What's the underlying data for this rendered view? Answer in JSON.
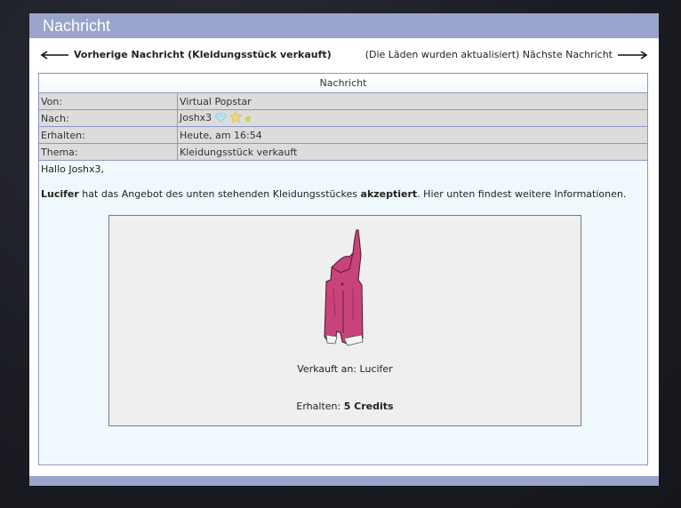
{
  "window": {
    "title": "Nachricht"
  },
  "nav": {
    "prev_label": "Vorherige Nachricht (Kleidungsstück verkauft)",
    "next_label": "(Die Läden wurden aktualisiert) Nächste Nachricht"
  },
  "message": {
    "header": "Nachricht",
    "fields": [
      {
        "key": "Von:",
        "value": "Virtual Popstar"
      },
      {
        "key": "Nach:",
        "value": "Joshx3"
      },
      {
        "key": "Erhalten:",
        "value": "Heute, am 16:54"
      },
      {
        "key": "Thema:",
        "value": "Kleidungsstück verkauft"
      }
    ],
    "greeting": "Hallo Joshx3,",
    "body": {
      "buyer": "Lucifer",
      "text1": " hat das Angebot des unten stehenden Kleidungsstückes ",
      "accepted": "akzeptiert",
      "text2": ". Hier unten findest weitere Informationen."
    },
    "sale": {
      "sold_to_label": "Verkauft an:",
      "sold_to": "Lucifer",
      "received_label": "Erhalten:",
      "received_amount": "5 Credits"
    }
  },
  "icons": [
    "left-arrow-icon",
    "right-arrow-icon",
    "diamond-icon",
    "star-icon",
    "online-dot-icon",
    "pink-overalls-image"
  ],
  "colors": {
    "title_bar": "#9aa4cc",
    "panel_border": "#8d97c2",
    "overalls": "#c8437a"
  }
}
